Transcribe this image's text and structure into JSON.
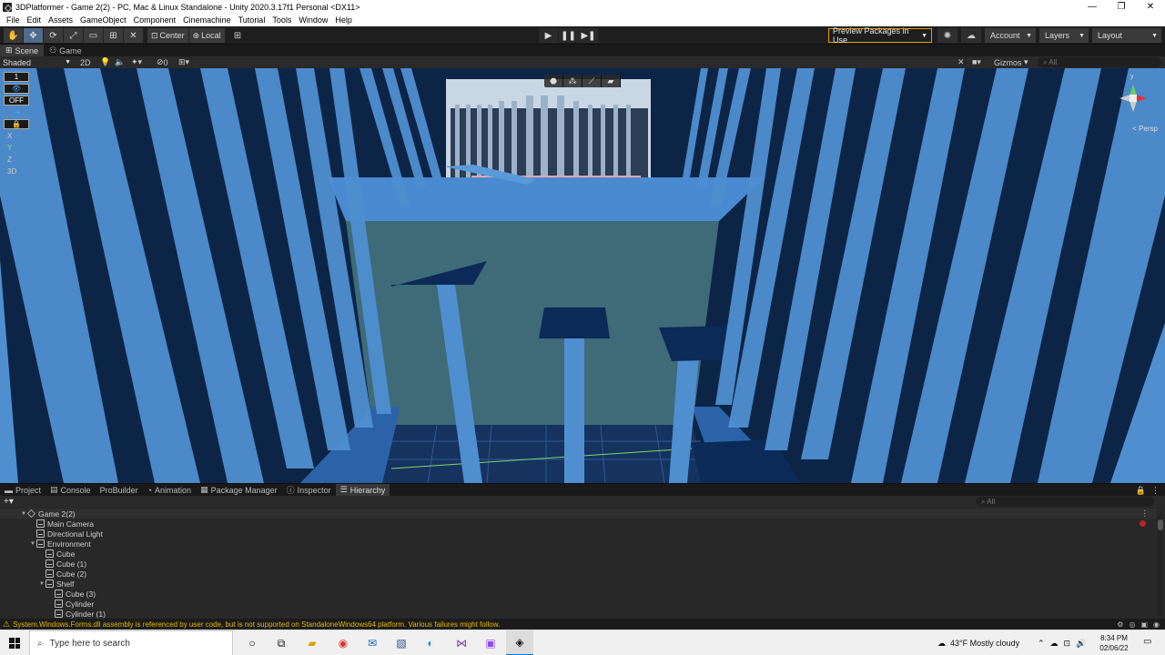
{
  "window": {
    "title": "3DPlatformer - Game 2(2) - PC, Mac & Linux Standalone - Unity 2020.3.17f1 Personal <DX11>",
    "minimize": "—",
    "maximize": "❐",
    "close": "✕"
  },
  "menu": [
    "File",
    "Edit",
    "Assets",
    "GameObject",
    "Component",
    "Cinemachine",
    "Tutorial",
    "Tools",
    "Window",
    "Help"
  ],
  "toolbar": {
    "pivot_label": "Center",
    "space_label": "Local",
    "preview_packages": "Preview Packages in Use",
    "account": "Account",
    "layers": "Layers",
    "layout": "Layout"
  },
  "scene_tabs": [
    "Scene",
    "Game"
  ],
  "scene_bar": {
    "shading": "Shaded",
    "mode_2d": "2D",
    "hidden_count": "0",
    "gizmos": "Gizmos",
    "search_placeholder": "All"
  },
  "scene_overlay": {
    "snap_increment": "1",
    "snap_off": "OFF",
    "x_label": "X",
    "y_label": "Y",
    "z_label": "Z",
    "mode_3d": "3D",
    "gizmo_y": "y",
    "projection": "< Persp"
  },
  "panel_tabs": [
    "Project",
    "Console",
    "ProBuilder",
    "Animation",
    "Package Manager",
    "Inspector",
    "Hierarchy"
  ],
  "panel_bar": {
    "add": "+▾",
    "search_placeholder": "All"
  },
  "hierarchy": {
    "root": "Game 2(2)",
    "items": [
      {
        "label": "Main Camera"
      },
      {
        "label": "Directional Light"
      },
      {
        "label": "Environment"
      },
      {
        "label": "Cube"
      },
      {
        "label": "Cube (1)"
      },
      {
        "label": "Cube (2)"
      },
      {
        "label": "Shelf"
      },
      {
        "label": "Cube (3)"
      },
      {
        "label": "Cylinder"
      },
      {
        "label": "Cylinder (1)"
      }
    ]
  },
  "status": {
    "message": "System.Windows.Forms.dll assembly is referenced by user code, but is not supported on StandaloneWindows64 platform. Various failures might follow."
  },
  "taskbar": {
    "search_placeholder": "Type here to search",
    "weather": "43°F  Mostly cloudy",
    "time": "8:34 PM",
    "date": "02/06/22"
  },
  "colors": {
    "sky": "#0d2240",
    "pillar": "#4f8fd0",
    "floor": "#3d6a7a",
    "platform": "#0b2a57",
    "warning": "#e6b800"
  }
}
